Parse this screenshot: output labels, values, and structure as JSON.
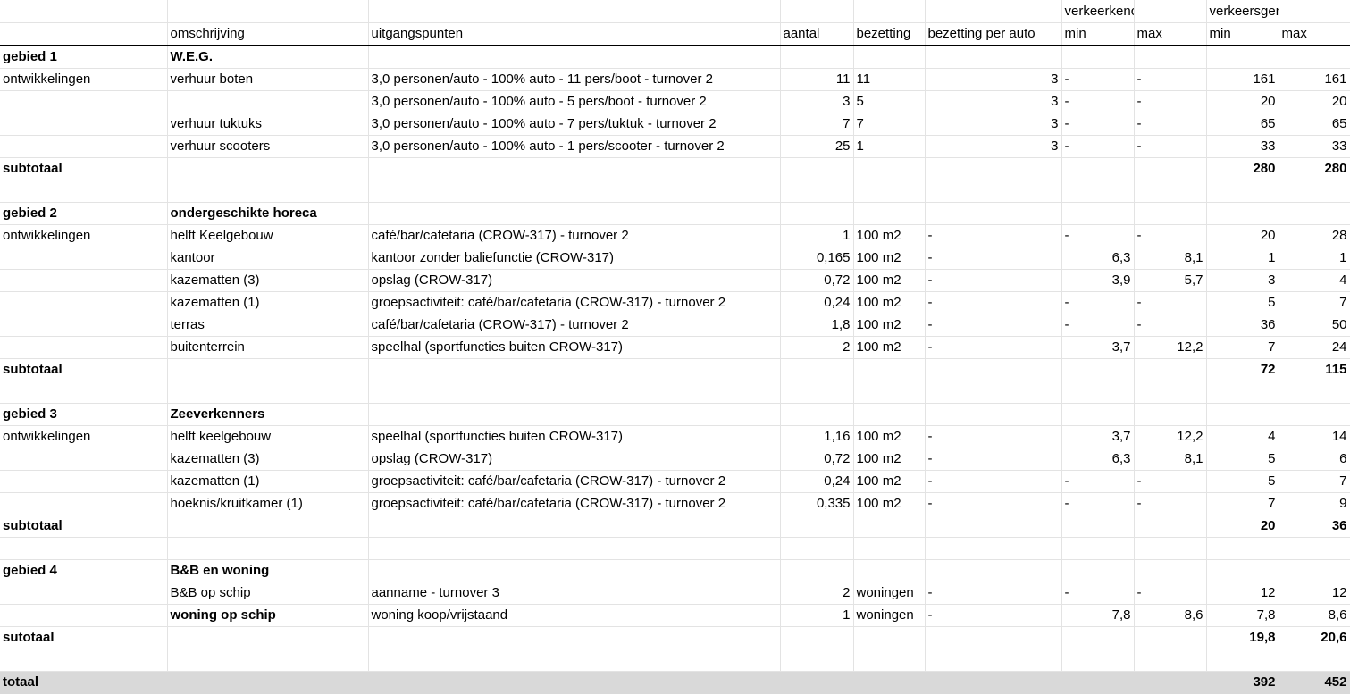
{
  "group_headers": {
    "verkeerkencijfer": "verkeerkencijfer",
    "verkeersgeneratie": "verkeersgeneratie"
  },
  "headers": [
    "",
    "omschrijving",
    "uitgangspunten",
    "aantal",
    "bezetting",
    "bezetting per auto",
    "min",
    "max",
    "min",
    "max"
  ],
  "rows": [
    {
      "type": "section",
      "cells": [
        "gebied 1",
        "W.E.G.",
        "",
        "",
        "",
        "",
        "",
        "",
        "",
        ""
      ]
    },
    {
      "type": "data",
      "cells": [
        "ontwikkelingen",
        "verhuur boten",
        "3,0 personen/auto - 100% auto - 11 pers/boot - turnover 2",
        "11",
        "11",
        "3",
        "-",
        "-",
        "161",
        "161"
      ]
    },
    {
      "type": "data",
      "cells": [
        "",
        "",
        "3,0 personen/auto - 100% auto - 5 pers/boot - turnover 2",
        "3",
        "5",
        "3",
        "-",
        "-",
        "20",
        "20"
      ]
    },
    {
      "type": "data",
      "cells": [
        "",
        "verhuur tuktuks",
        "3,0 personen/auto - 100% auto - 7 pers/tuktuk - turnover 2",
        "7",
        "7",
        "3",
        "-",
        "-",
        "65",
        "65"
      ]
    },
    {
      "type": "data",
      "cells": [
        "",
        "verhuur scooters",
        "3,0 personen/auto - 100% auto - 1 pers/scooter - turnover 2",
        "25",
        "1",
        "3",
        "-",
        "-",
        "33",
        "33"
      ]
    },
    {
      "type": "subtotal",
      "cells": [
        "subtotaal",
        "",
        "",
        "",
        "",
        "",
        "",
        "",
        "280",
        "280"
      ]
    },
    {
      "type": "empty",
      "cells": [
        "",
        "",
        "",
        "",
        "",
        "",
        "",
        "",
        "",
        ""
      ]
    },
    {
      "type": "section",
      "cells": [
        "gebied 2",
        "ondergeschikte horeca",
        "",
        "",
        "",
        "",
        "",
        "",
        "",
        ""
      ]
    },
    {
      "type": "data",
      "cells": [
        "ontwikkelingen",
        "helft Keelgebouw",
        "café/bar/cafetaria (CROW-317) - turnover 2",
        "1",
        "100 m2",
        "-",
        "-",
        "-",
        "20",
        "28"
      ]
    },
    {
      "type": "data",
      "cells": [
        "",
        "kantoor",
        "kantoor zonder baliefunctie (CROW-317)",
        "0,165",
        "100 m2",
        "-",
        "6,3",
        "8,1",
        "1",
        "1"
      ]
    },
    {
      "type": "data",
      "cells": [
        "",
        "kazematten (3)",
        "opslag (CROW-317)",
        "0,72",
        "100 m2",
        "-",
        "3,9",
        "5,7",
        "3",
        "4"
      ]
    },
    {
      "type": "data",
      "cells": [
        "",
        "kazematten (1)",
        "groepsactiviteit: café/bar/cafetaria (CROW-317) - turnover 2",
        "0,24",
        "100 m2",
        "-",
        "-",
        "-",
        "5",
        "7"
      ]
    },
    {
      "type": "data",
      "cells": [
        "",
        "terras",
        "café/bar/cafetaria (CROW-317) - turnover 2",
        "1,8",
        "100 m2",
        "-",
        "-",
        "-",
        "36",
        "50"
      ]
    },
    {
      "type": "data",
      "cells": [
        "",
        "buitenterrein",
        "speelhal (sportfuncties buiten CROW-317)",
        "2",
        "100 m2",
        "-",
        "3,7",
        "12,2",
        "7",
        "24"
      ]
    },
    {
      "type": "subtotal",
      "cells": [
        "subtotaal",
        "",
        "",
        "",
        "",
        "",
        "",
        "",
        "72",
        "115"
      ]
    },
    {
      "type": "empty",
      "cells": [
        "",
        "",
        "",
        "",
        "",
        "",
        "",
        "",
        "",
        ""
      ]
    },
    {
      "type": "section",
      "cells": [
        "gebied 3",
        "Zeeverkenners",
        "",
        "",
        "",
        "",
        "",
        "",
        "",
        ""
      ]
    },
    {
      "type": "data",
      "cells": [
        "ontwikkelingen",
        "helft keelgebouw",
        "speelhal (sportfuncties buiten CROW-317)",
        "1,16",
        "100 m2",
        "-",
        "3,7",
        "12,2",
        "4",
        "14"
      ]
    },
    {
      "type": "data",
      "cells": [
        "",
        "kazematten (3)",
        "opslag (CROW-317)",
        "0,72",
        "100 m2",
        "-",
        "6,3",
        "8,1",
        "5",
        "6"
      ]
    },
    {
      "type": "data",
      "cells": [
        "",
        "kazematten (1)",
        "groepsactiviteit: café/bar/cafetaria (CROW-317) - turnover 2",
        "0,24",
        "100 m2",
        "-",
        "-",
        "-",
        "5",
        "7"
      ]
    },
    {
      "type": "data",
      "cells": [
        "",
        "hoeknis/kruitkamer (1)",
        "groepsactiviteit: café/bar/cafetaria (CROW-317) - turnover 2",
        "0,335",
        "100 m2",
        "-",
        "-",
        "-",
        "7",
        "9"
      ]
    },
    {
      "type": "subtotal",
      "cells": [
        "subtotaal",
        "",
        "",
        "",
        "",
        "",
        "",
        "",
        "20",
        "36"
      ]
    },
    {
      "type": "empty",
      "cells": [
        "",
        "",
        "",
        "",
        "",
        "",
        "",
        "",
        "",
        ""
      ]
    },
    {
      "type": "section",
      "cells": [
        "gebied 4",
        "B&B en woning",
        "",
        "",
        "",
        "",
        "",
        "",
        "",
        ""
      ]
    },
    {
      "type": "data",
      "cells": [
        "",
        "B&B op schip",
        "aanname - turnover 3",
        "2",
        "woningen",
        "-",
        "-",
        "-",
        "12",
        "12"
      ]
    },
    {
      "type": "data-bold-desc",
      "cells": [
        "",
        "woning op schip",
        "woning koop/vrijstaand",
        "1",
        "woningen",
        "-",
        "7,8",
        "8,6",
        "7,8",
        "8,6"
      ]
    },
    {
      "type": "subtotal",
      "cells": [
        "sutotaal",
        "",
        "",
        "",
        "",
        "",
        "",
        "",
        "19,8",
        "20,6"
      ]
    },
    {
      "type": "empty",
      "cells": [
        "",
        "",
        "",
        "",
        "",
        "",
        "",
        "",
        "",
        ""
      ]
    },
    {
      "type": "total",
      "cells": [
        "totaal",
        "",
        "",
        "",
        "",
        "",
        "",
        "",
        "392",
        "452"
      ]
    }
  ]
}
